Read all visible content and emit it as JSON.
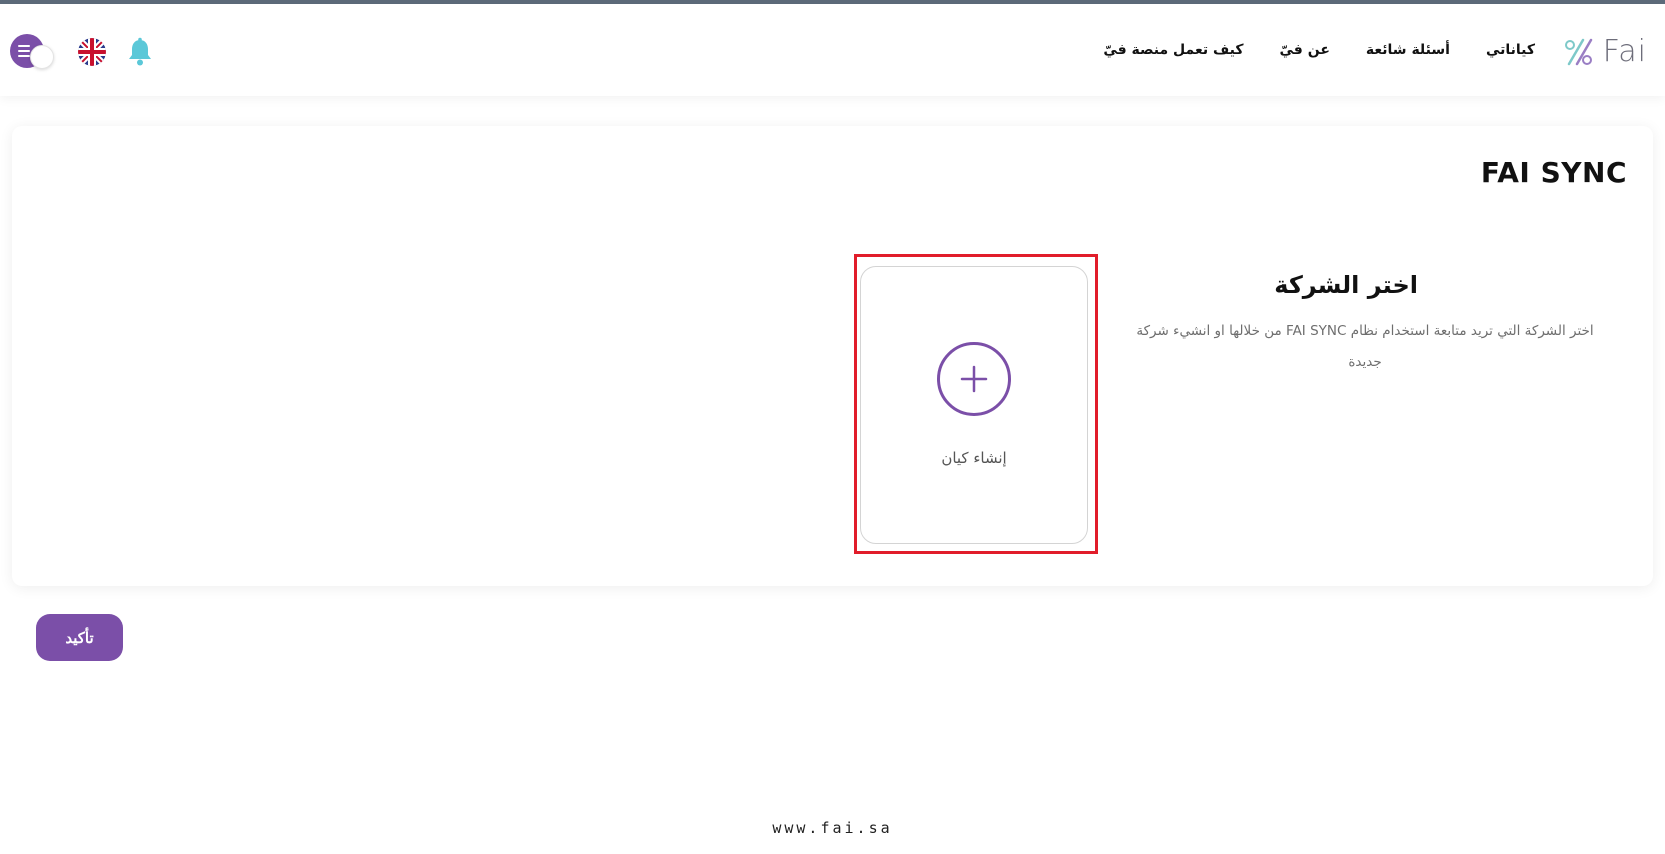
{
  "header": {
    "logo_text": "Fai",
    "nav": [
      {
        "label": "كيف تعمل منصة فيّ"
      },
      {
        "label": "عن فيّ"
      },
      {
        "label": "أسئلة شائعة"
      },
      {
        "label": "كياناتي"
      }
    ],
    "icons": [
      "menu-icon",
      "uk-flag-icon",
      "bell-icon"
    ]
  },
  "main": {
    "title": "FAI SYNC",
    "section_title": "اختر الشركة",
    "section_desc": "اختر الشركة التي تريد متابعة استخدام نظام FAI SYNC من خلالها او انشيء شركة جديدة",
    "create_label": "إنشاء كيان",
    "confirm_label": "تأكيد"
  },
  "footer": {
    "url": "www.fai.sa"
  },
  "colors": {
    "accent": "#7b4fa8",
    "highlight": "#e11d2a",
    "bell": "#5bc8d8"
  }
}
